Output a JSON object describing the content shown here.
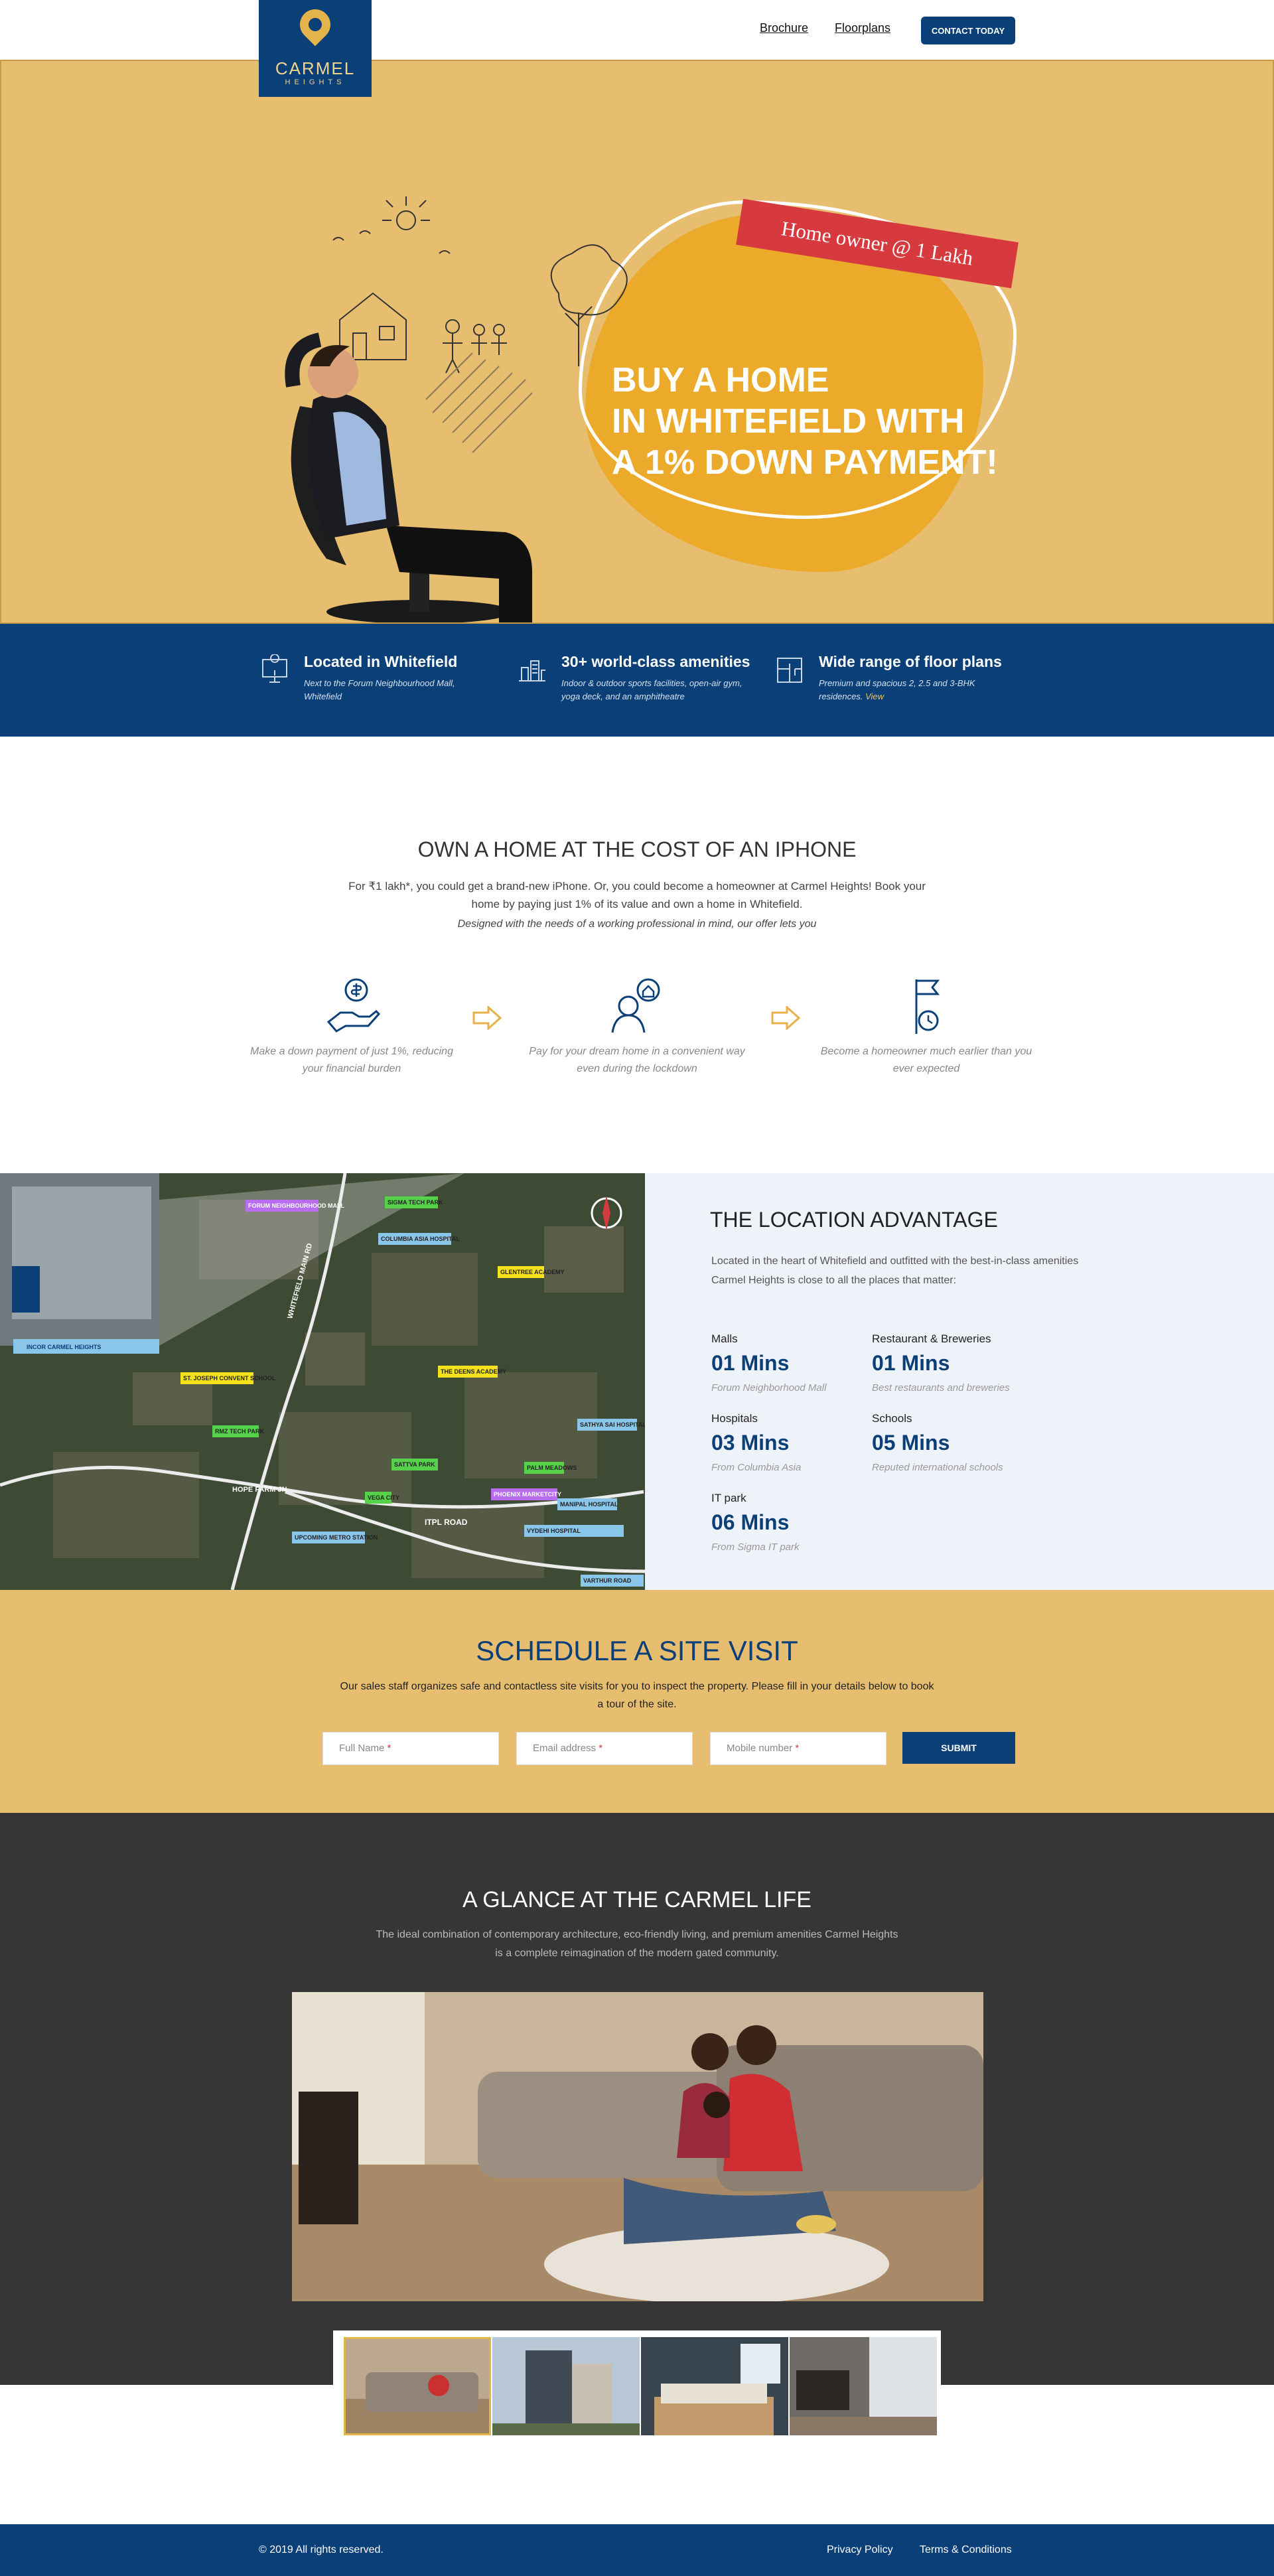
{
  "brand": {
    "name": "CARMEL",
    "tagline": "HEIGHTS"
  },
  "nav": {
    "brochure": "Brochure",
    "floorplans": "Floorplans",
    "contact": "CONTACT TODAY"
  },
  "hero": {
    "ribbon": "Home owner @ 1 Lakh",
    "headline_1": "BUY A HOME",
    "headline_2": "IN WHITEFIELD WITH",
    "headline_3": "A 1% DOWN PAYMENT!"
  },
  "features": [
    {
      "title": "Located in Whitefield",
      "desc": "Next to the Forum Neighbourhood Mall, Whitefield",
      "icon": "location-icon"
    },
    {
      "title": "30+ world-class amenities",
      "desc": "Indoor & outdoor sports facilities, open-air gym, yoga deck, and an amphitheatre",
      "icon": "building-icon"
    },
    {
      "title": "Wide range of floor plans",
      "desc": "Premium and spacious 2, 2.5 and 3-BHK residences.",
      "link": "View",
      "icon": "floorplan-icon"
    }
  ],
  "own": {
    "title": "OWN A HOME AT THE COST OF AN IPHONE",
    "text": "For ₹1 lakh*, you could get a brand-new iPhone. Or, you could become a homeowner at Carmel Heights! Book your home by paying just 1% of its value and own a home in Whitefield.",
    "italic": "Designed with the needs of a working professional in mind, our offer lets you",
    "steps": [
      {
        "text": "Make a down payment of just 1%, reducing your financial burden",
        "icon": "money-hand-icon"
      },
      {
        "text": "Pay for your dream home in a convenient way even during the lockdown",
        "icon": "person-home-icon"
      },
      {
        "text": "Become a homeowner much earlier than you ever expected",
        "icon": "flag-clock-icon"
      }
    ]
  },
  "map": {
    "labels": [
      "INCOR CARMEL HEIGHTS",
      "ST. JOSEPH CONVENT SCHOOL",
      "RMZ TECH PARK",
      "ITPL ROAD",
      "UPCOMING METRO STATION",
      "COLUMBIA ASIA HOSPITAL",
      "SIGMA TECH PARK",
      "THE DEENS ACADEMY",
      "GLENTREE ACADEMY",
      "FORUM NEIGHBOURHOOD MALL",
      "SATHYA SAI HOSPITAL",
      "SATTVA PARK",
      "VYDEHI HOSPITAL",
      "MANIPAL HOSPITAL",
      "PHOENIX MARKETCITY",
      "VEGA CITY",
      "PALM MEADOWS",
      "HOPE FARM JN",
      "WHITEFIELD MAIN RD",
      "VARTHUR ROAD"
    ]
  },
  "location": {
    "title": "THE LOCATION ADVANTAGE",
    "desc": "Located in the heart of Whitefield and outfitted with the best-in-class amenities Carmel Heights is close to all the places that matter:",
    "stats": [
      {
        "label": "Malls",
        "value": "01 Mins",
        "sub": "Forum Neighborhood Mall"
      },
      {
        "label": "Restaurant & Breweries",
        "value": "01 Mins",
        "sub": "Best restaurants and breweries"
      },
      {
        "label": "Hospitals",
        "value": "03 Mins",
        "sub": "From Columbia Asia"
      },
      {
        "label": "Schools",
        "value": "05 Mins",
        "sub": "Reputed international schools"
      },
      {
        "label": "IT park",
        "value": "06 Mins",
        "sub": "From Sigma IT park"
      }
    ]
  },
  "schedule": {
    "title": "SCHEDULE A SITE VISIT",
    "text": "Our sales staff organizes safe and contactless site visits for you to inspect the property. Please fill in your details below to book a tour of the site.",
    "fields": [
      {
        "placeholder": "Full Name"
      },
      {
        "placeholder": "Email address"
      },
      {
        "placeholder": "Mobile number"
      }
    ],
    "required_mark": "*",
    "submit": "SUBMIT"
  },
  "glance": {
    "title": "A GLANCE AT THE CARMEL LIFE",
    "text": "The ideal combination of contemporary architecture, eco-friendly living, and premium amenities Carmel Heights is a complete reimagination of the modern gated community."
  },
  "footer": {
    "copyright": "© 2019 All rights reserved.",
    "privacy": "Privacy Policy",
    "terms": "Terms & Conditions"
  },
  "colors": {
    "navy": "#0b3f78",
    "sand": "#e7bd6f",
    "orange": "#ecaa2a",
    "red": "#d63a3f",
    "charcoal": "#363636"
  }
}
